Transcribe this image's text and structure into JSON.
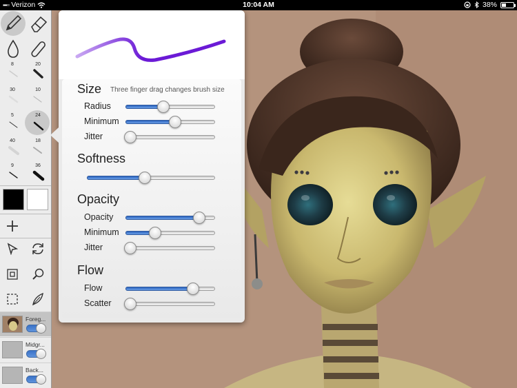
{
  "status_bar": {
    "carrier": "Verizon",
    "time": "10:04 AM",
    "battery_percent": "38%",
    "battery_level": 0.38
  },
  "toolbar": {
    "tools": [
      "pencil-icon",
      "eraser-icon",
      "smudge-drop-icon",
      "paint-tube-icon"
    ],
    "brush_sizes": [
      "8",
      "20",
      "30",
      "10",
      "5",
      "24",
      "40",
      "18",
      "9",
      "36"
    ],
    "selected_brush_size": "24",
    "colors": {
      "primary": "#000000",
      "secondary": "#ffffff"
    }
  },
  "layers": [
    {
      "name": "Foreg...",
      "visible": true,
      "active": true
    },
    {
      "name": "Midgr...",
      "visible": true,
      "active": false
    },
    {
      "name": "Back...",
      "visible": true,
      "active": false
    }
  ],
  "brush_popover": {
    "stroke_colors": {
      "start": "#c9a8f2",
      "end": "#6b1ad6"
    },
    "size": {
      "title": "Size",
      "hint": "Three finger drag changes brush size",
      "sliders": [
        {
          "label": "Radius",
          "value": 0.42
        },
        {
          "label": "Minimum",
          "value": 0.55
        },
        {
          "label": "Jitter",
          "value": 0.05
        }
      ]
    },
    "softness": {
      "title": "Softness",
      "value": 0.45
    },
    "opacity": {
      "title": "Opacity",
      "sliders": [
        {
          "label": "Opacity",
          "value": 0.82
        },
        {
          "label": "Minimum",
          "value": 0.33
        },
        {
          "label": "Jitter",
          "value": 0.05
        }
      ]
    },
    "flow": {
      "title": "Flow",
      "sliders": [
        {
          "label": "Flow",
          "value": 0.75
        },
        {
          "label": "Scatter",
          "value": 0.05
        }
      ]
    }
  }
}
